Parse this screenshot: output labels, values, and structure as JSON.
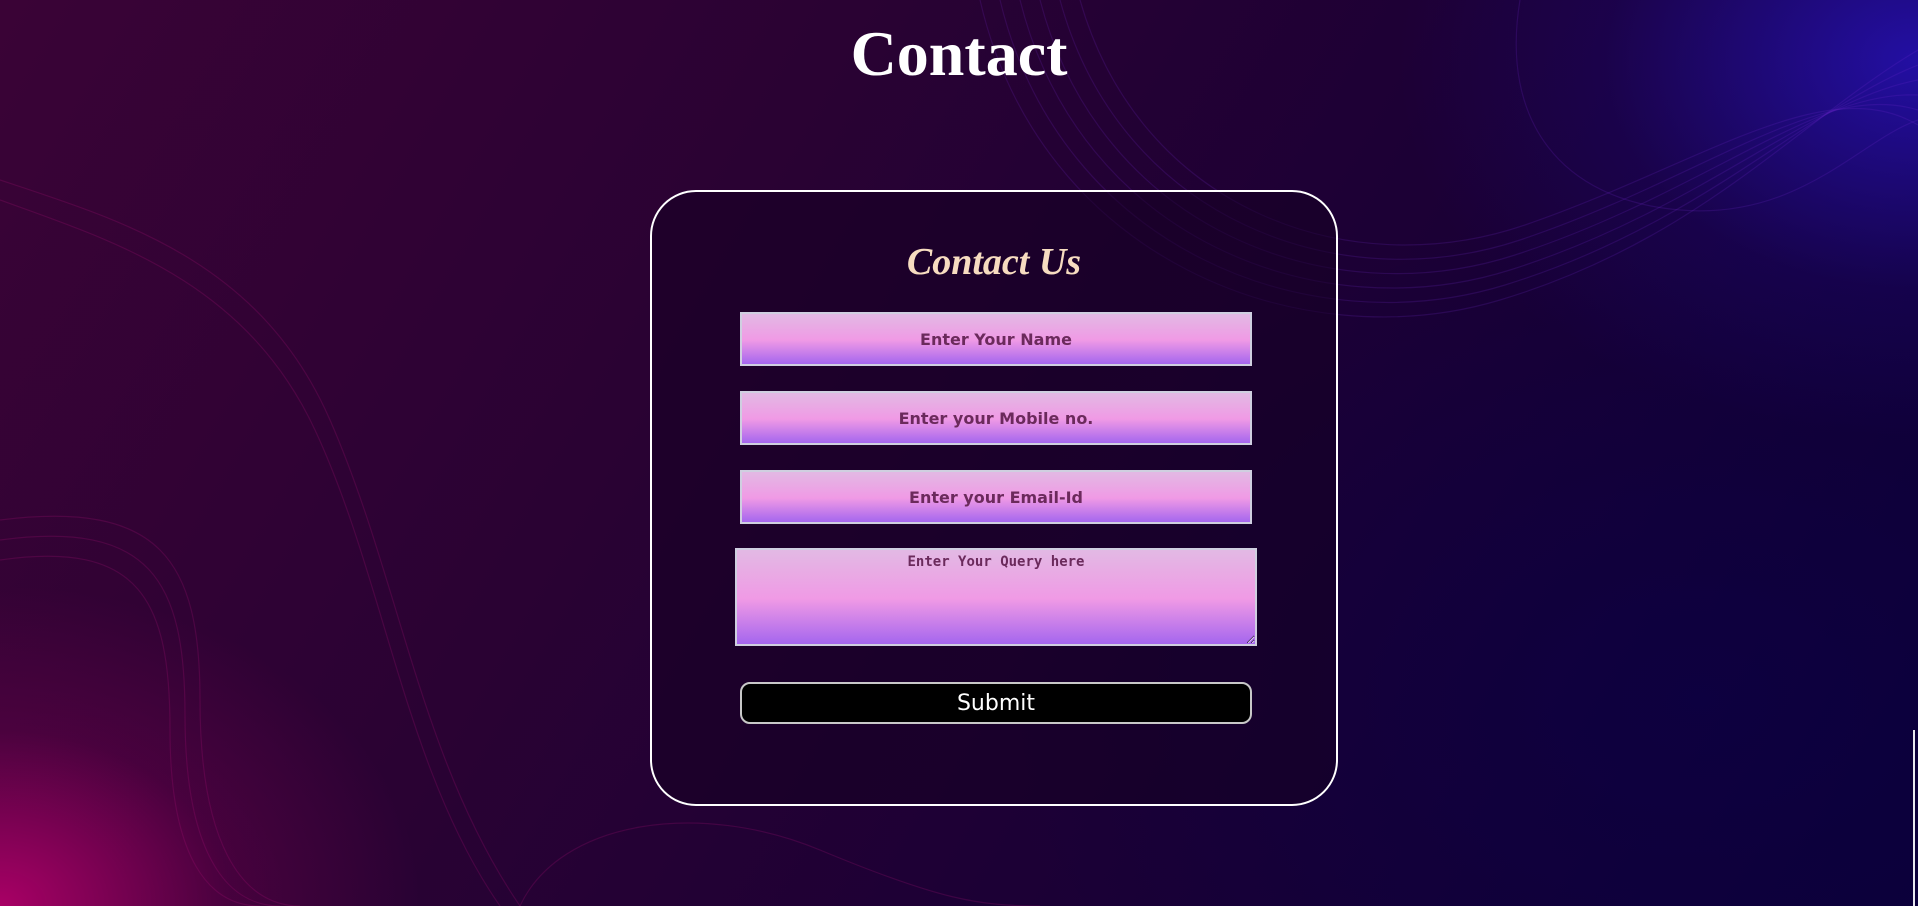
{
  "page": {
    "title": "Contact"
  },
  "form": {
    "heading": "Contact Us",
    "name_placeholder": "Enter Your Name",
    "mobile_placeholder": "Enter your Mobile no.",
    "email_placeholder": "Enter your Email-Id",
    "query_placeholder": "Enter Your Query here",
    "submit_label": "Submit"
  },
  "colors": {
    "title_text": "#ffffff",
    "card_heading": "#f7dcc0",
    "field_text": "#6b2a5c",
    "button_bg": "#000000"
  }
}
